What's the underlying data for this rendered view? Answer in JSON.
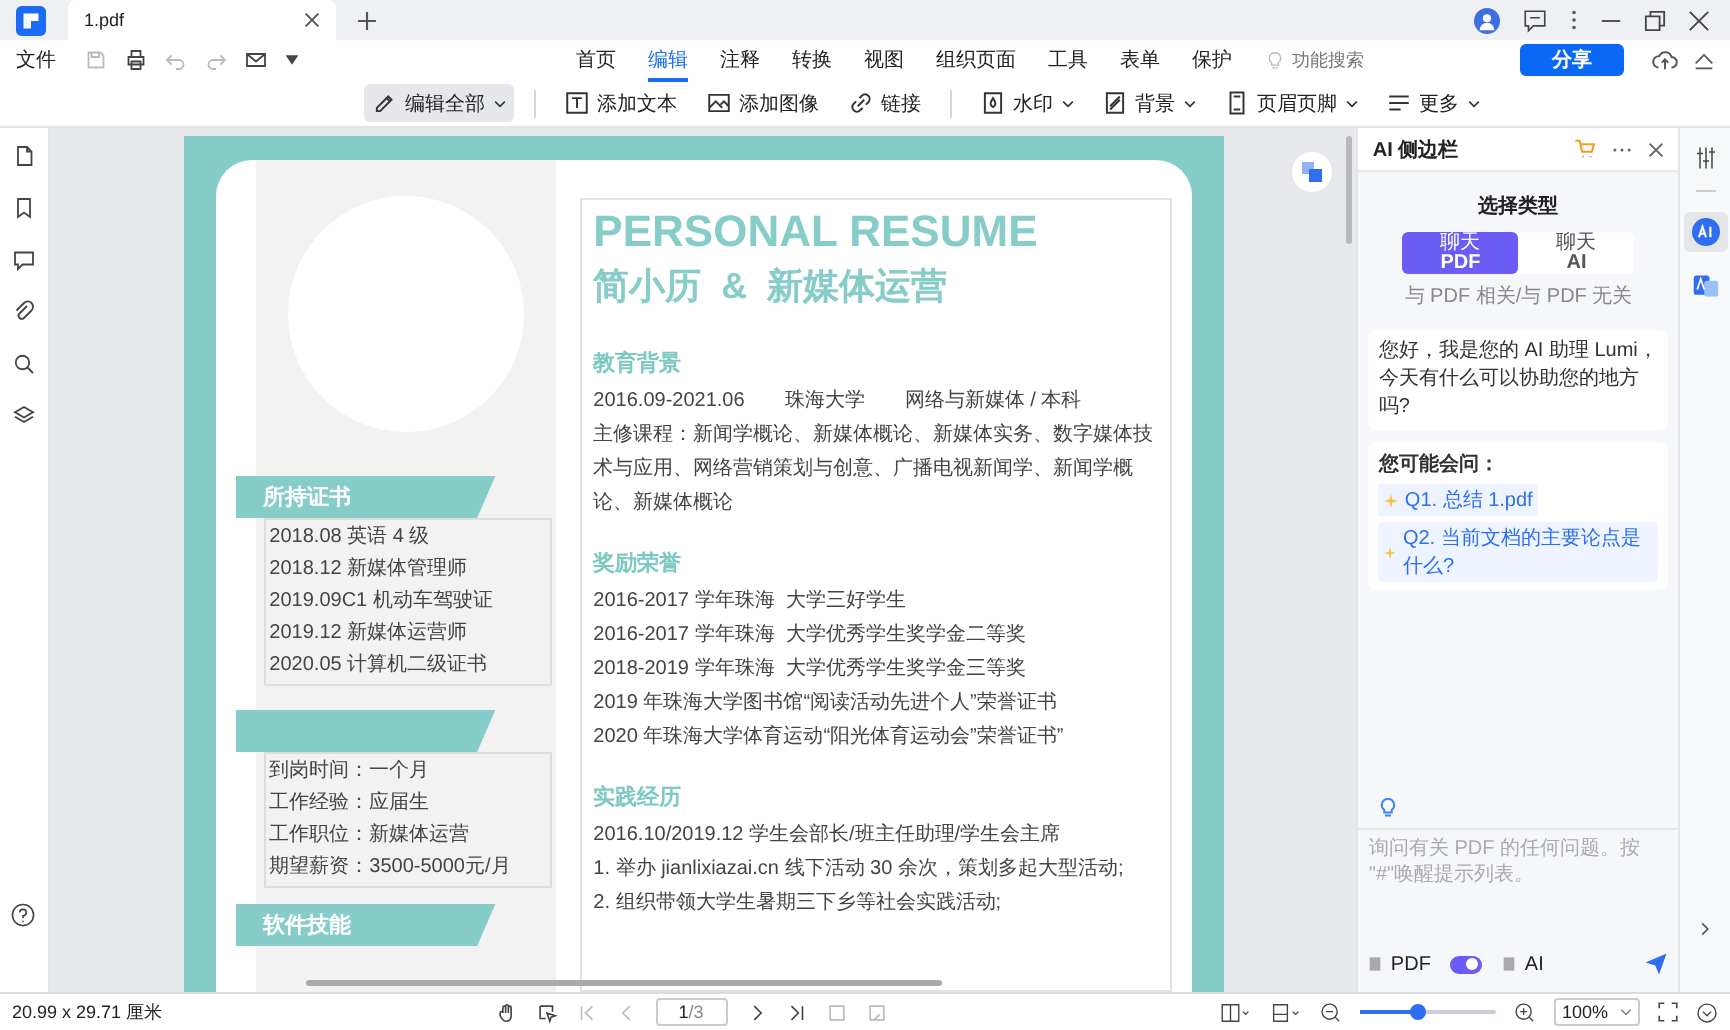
{
  "tab": {
    "title": "1.pdf"
  },
  "menu": {
    "file": "文件",
    "tabs": [
      {
        "label": "首页",
        "selected": false
      },
      {
        "label": "编辑",
        "selected": true
      },
      {
        "label": "注释",
        "selected": false
      },
      {
        "label": "转换",
        "selected": false
      },
      {
        "label": "视图",
        "selected": false
      },
      {
        "label": "组织页面",
        "selected": false
      },
      {
        "label": "工具",
        "selected": false
      },
      {
        "label": "表单",
        "selected": false
      },
      {
        "label": "保护",
        "selected": false
      }
    ],
    "search": {
      "placeholder": "功能搜索"
    },
    "share": "分享"
  },
  "toolbar": [
    {
      "label": "编辑全部",
      "selected": true,
      "dropdown": true
    },
    {
      "label": "添加文本",
      "selected": false,
      "dropdown": false
    },
    {
      "label": "添加图像",
      "selected": false,
      "dropdown": false
    },
    {
      "label": "链接",
      "selected": false,
      "dropdown": false
    },
    {
      "label": "水印",
      "selected": false,
      "dropdown": true
    },
    {
      "label": "背景",
      "selected": false,
      "dropdown": true
    },
    {
      "label": "页眉页脚",
      "selected": false,
      "dropdown": true
    },
    {
      "label": "更多",
      "selected": false,
      "dropdown": true
    }
  ],
  "document": {
    "title": "PERSONAL RESUME",
    "subtitle": "简小历  &  新媒体运营",
    "certificates": {
      "heading": "所持证书",
      "items": [
        "2018.08 英语 4 级",
        "2018.12 新媒体管理师",
        "2019.09C1 机动车驾驶证",
        "2019.12 新媒体运营师",
        "2020.05 计算机二级证书"
      ]
    },
    "job": {
      "items": [
        "到岗时间：一个月",
        "工作经验：应届生",
        "工作职位：新媒体运营",
        "期望薪资：3500-5000元/月"
      ]
    },
    "skills": {
      "heading": "软件技能"
    },
    "sections": [
      {
        "heading": "教育背景",
        "row": [
          "2016.09-2021.06",
          "珠海大学",
          "网络与新媒体 / 本科"
        ],
        "lines": [
          "主修课程：新闻学概论、新媒体概论、新媒体实务、数字媒体技术与应用、网络营销策划与创意、广播电视新闻学、新闻学概论、新媒体概论"
        ]
      },
      {
        "heading": "奖励荣誉",
        "lines": [
          "2016-2017 学年珠海  大学三好学生",
          "2016-2017 学年珠海  大学优秀学生奖学金二等奖",
          "2018-2019 学年珠海  大学优秀学生奖学金三等奖",
          "2019 年珠海大学图书馆“阅读活动先进个人”荣誉证书",
          "2020 年珠海大学体育运动“阳光体育运动会”荣誉证书”"
        ]
      },
      {
        "heading": "实践经历",
        "lines": [
          "2016.10/2019.12 学生会部长/班主任助理/学生会主席",
          "1. 举办 jianlixiazai.cn 线下活动 30 余次，策划多起大型活动;",
          "2. 组织带领大学生暑期三下乡等社会实践活动;"
        ]
      }
    ]
  },
  "ai_panel": {
    "title": "AI 侧边栏",
    "type_heading": "选择类型",
    "modes": [
      {
        "label": "聊天",
        "sub": "PDF",
        "selected": true
      },
      {
        "label": "聊天",
        "sub": "AI",
        "selected": false
      }
    ],
    "mode_hint": "与 PDF 相关/与 PDF 无关",
    "greeting": "您好，我是您的 AI 助理 Lumi，今天有什么可以协助您的地方吗?",
    "suggestions": {
      "heading": "您可能会问：",
      "items": [
        "Q1. 总结 1.pdf",
        "Q2. 当前文档的主要论点是什么?"
      ]
    },
    "input": {
      "placeholder": "询问有关 PDF 的任何问题。按 \"#\"唤醒提示列表。"
    },
    "scope": {
      "left": "PDF",
      "right": "AI",
      "on": true
    }
  },
  "status_bar": {
    "size": "20.99 x 29.71 厘米",
    "page": "1",
    "page_total": "/3",
    "zoom": {
      "level": 0.42,
      "value": "100%"
    }
  }
}
